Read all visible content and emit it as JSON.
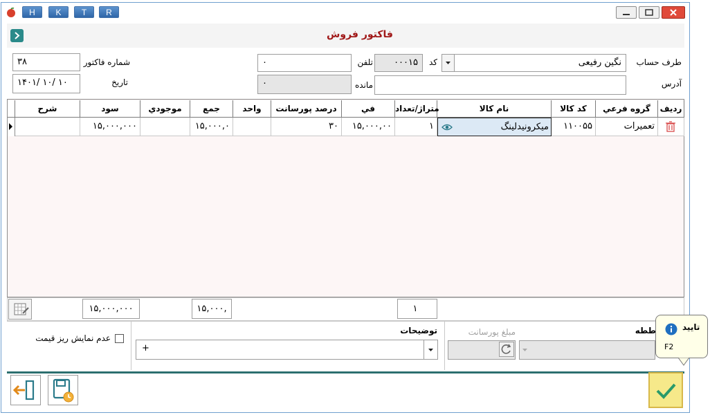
{
  "titlebar": {
    "buttons": [
      "H",
      "K",
      "T",
      "R"
    ]
  },
  "form": {
    "title": "فاکتور فروش"
  },
  "fields": {
    "account_label": "طرف حساب",
    "account_value": "نگین رفیعی",
    "code_label": "کد",
    "code_value": "۰۰۰۱۵",
    "phone_label": "تلفن",
    "phone_value": "۰",
    "invoice_no_label": "شماره فاکتور",
    "invoice_no_value": "۳۸",
    "address_label": "آدرس",
    "address_value": "",
    "balance_label": "مانده",
    "balance_value": "۰",
    "date_label": "تاریخ",
    "date_value": "۱۴۰۱/ ۱۰/ ۱۰"
  },
  "grid": {
    "columns": [
      "ردیف",
      "گروه فرعي",
      "کد کالا",
      "نام کالا",
      "متراژ/تعداد",
      "في",
      "درصد پورسانت",
      "واحد",
      "جمع",
      "موجودي",
      "سود",
      "شرح"
    ],
    "row": {
      "group": "تعميرات",
      "code": "۱۱۰۰۵۵",
      "name": "ميکرونيدلينگ",
      "qty": "۱",
      "price": "۱۵,۰۰۰,۰۰",
      "commission": "۳۰",
      "unit": "",
      "total": "۱۵,۰۰۰,۰",
      "stock": "",
      "profit": "۱۵,۰۰۰,۰۰۰",
      "desc": ""
    }
  },
  "footer": {
    "qty_total": "۱",
    "sum_total": "۱۵,۰۰۰,",
    "profit_total": "۱۵,۰۰۰,۰۰۰"
  },
  "bottom": {
    "hide_detail_label": "عدم نمايش ريز قيمت",
    "notes_label": "توضيحات",
    "notes_value": "+",
    "commission_amount_label": "مبلغ پورسانت",
    "partial_label": "ططه"
  },
  "tooltip": {
    "title": "تایید",
    "shortcut": "F2"
  },
  "colors": {
    "title": "#a01818",
    "accent": "#2c6f6f",
    "confirm_bg": "#f6e98a"
  }
}
